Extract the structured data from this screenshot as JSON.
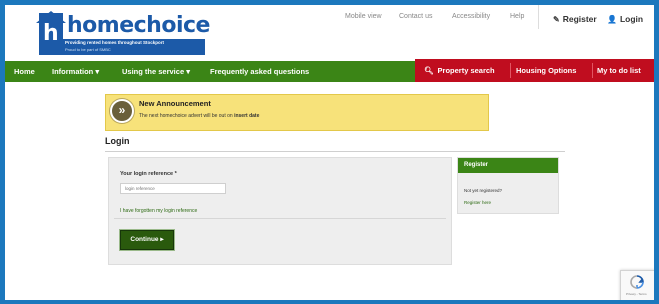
{
  "header": {
    "logo": {
      "letter": "h",
      "wordmark": "homechoice",
      "tagline": "Providing rented homes throughout Stockport",
      "subtag": "Proud to be part of SMBC"
    },
    "top_links": [
      "Mobile view",
      "Contact us",
      "Accessibility",
      "Help"
    ],
    "register_label": "Register",
    "login_label": "Login"
  },
  "nav": {
    "items": [
      "Home",
      "Information ▾",
      "Using the service ▾",
      "Frequently asked questions"
    ],
    "right_items": [
      "Property search",
      "Housing Options",
      "My to do list"
    ]
  },
  "announcement": {
    "title": "New Announcement",
    "text_prefix": "The next homechoice advert will be out on",
    "text_bold": "insert date"
  },
  "page": {
    "title": "Login"
  },
  "login_form": {
    "label": "Your login reference *",
    "placeholder": "login reference",
    "forgot_link": "I have forgotten my login reference",
    "continue_label": "Continue ▸"
  },
  "register_box": {
    "heading": "Register",
    "question": "Not yet registered?",
    "link": "Register here"
  },
  "recaptcha": {
    "text": "Privacy - Terms"
  },
  "colors": {
    "brand_blue": "#1c5aa8",
    "nav_green": "#3b8516",
    "nav_red": "#c00d1f",
    "announcement_yellow": "#f7e27a",
    "continue_green": "#2a5a0d"
  }
}
